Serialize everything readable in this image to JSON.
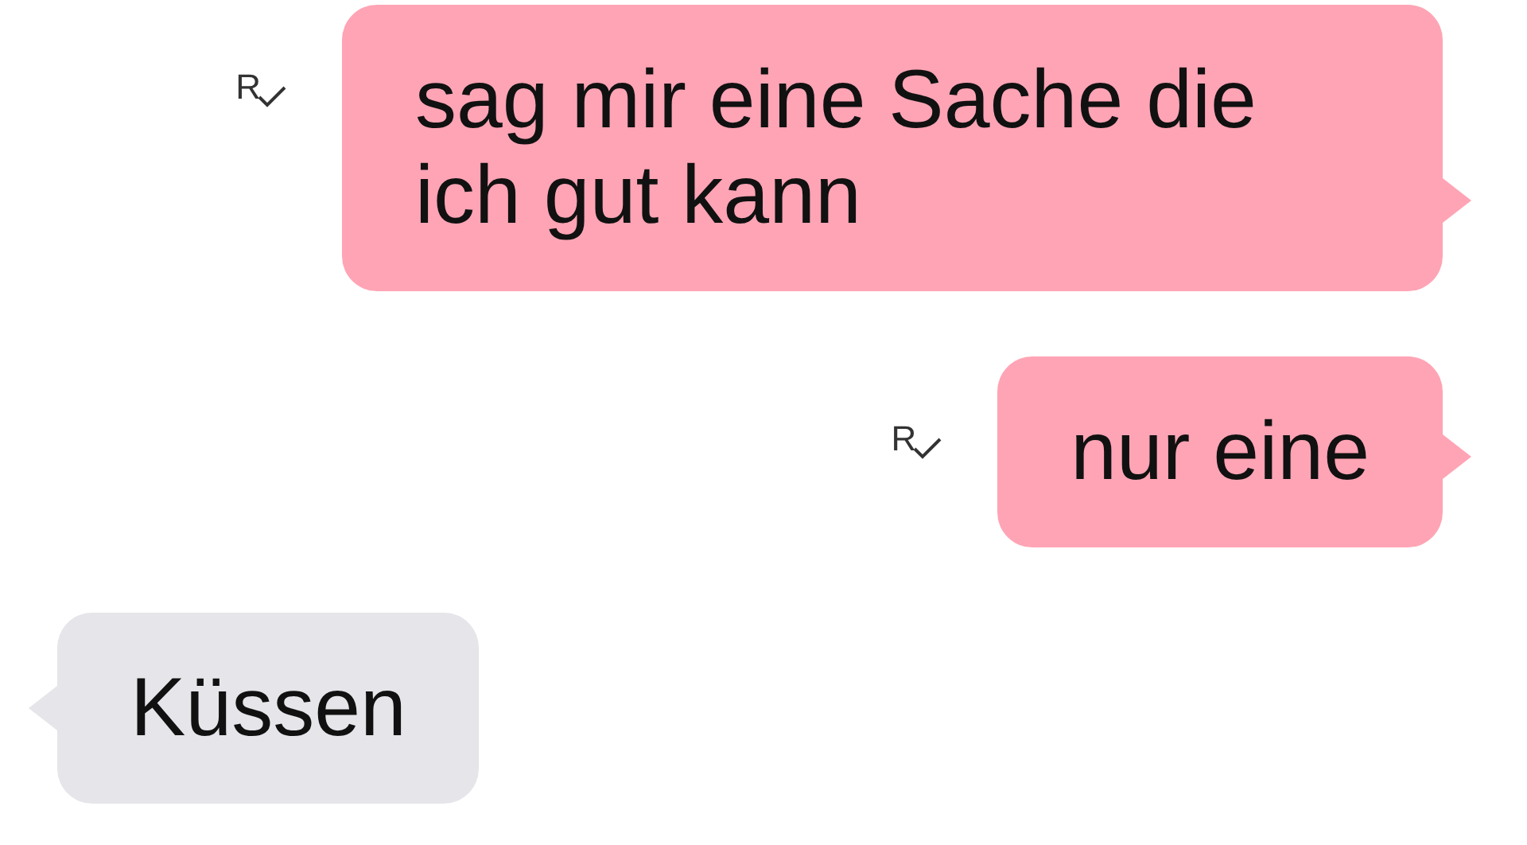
{
  "messages": [
    {
      "kind": "sent",
      "text": "sag mir eine Sache die ich gut kann",
      "receipt": "R"
    },
    {
      "kind": "sent",
      "text": "nur eine",
      "receipt": "R"
    },
    {
      "kind": "received",
      "text": "Küssen"
    }
  ]
}
